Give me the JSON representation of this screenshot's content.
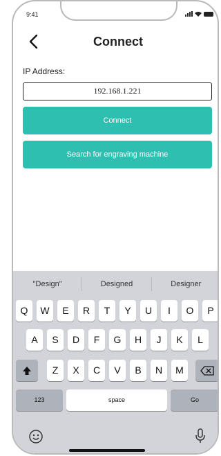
{
  "status": {
    "time": "9:41"
  },
  "header": {
    "title": "Connect"
  },
  "form": {
    "ip_label": "IP Address:",
    "ip_value": "192.168.1.221",
    "connect_button": "Connect",
    "search_button": "Search for engraving machine"
  },
  "keyboard": {
    "suggestions": [
      "\"Design\"",
      "Designed",
      "Designer"
    ],
    "row1": [
      "Q",
      "W",
      "E",
      "R",
      "T",
      "Y",
      "U",
      "I",
      "O",
      "P"
    ],
    "row2": [
      "A",
      "S",
      "D",
      "F",
      "G",
      "H",
      "J",
      "K",
      "L"
    ],
    "row3": [
      "Z",
      "X",
      "C",
      "V",
      "B",
      "N",
      "M"
    ],
    "numbers_key": "123",
    "space_key": "space",
    "go_key": "Go"
  },
  "colors": {
    "accent": "#2fbfb1",
    "keyboard_bg": "#d2d4d9"
  },
  "icons": [
    "back-chevron-icon",
    "shift-icon",
    "delete-icon",
    "emoji-icon",
    "microphone-icon"
  ]
}
